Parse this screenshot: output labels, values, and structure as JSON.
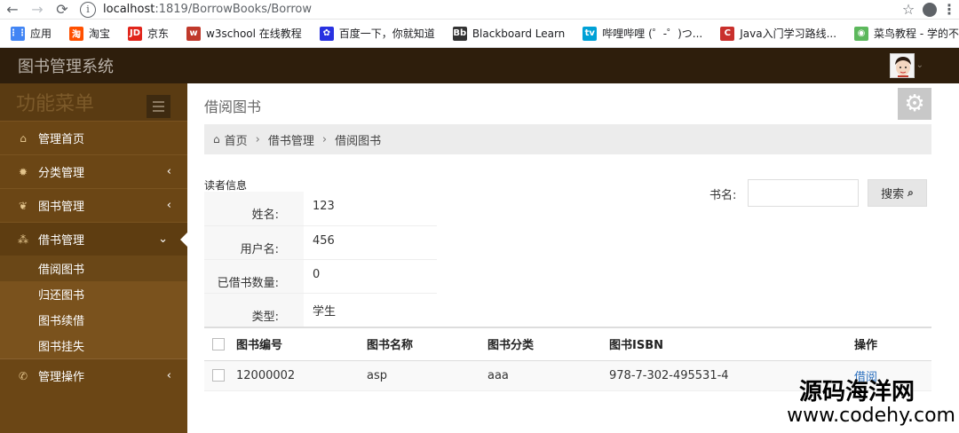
{
  "browser": {
    "host": "localhost",
    "path": ":1819/BorrowBooks/Borrow",
    "bookmarks": [
      {
        "label": "应用",
        "icon": "apps-grid-icon",
        "color": "#4285f4"
      },
      {
        "label": "淘宝",
        "icon": "taobao-icon",
        "color": "#ff5000"
      },
      {
        "label": "京东",
        "icon": "jd-icon",
        "color": "#e1251b"
      },
      {
        "label": "w3school 在线教程",
        "icon": "w3school-icon",
        "color": "#c0392b"
      },
      {
        "label": "百度一下，你就知道",
        "icon": "baidu-paw-icon",
        "color": "#2932e1"
      },
      {
        "label": "Blackboard Learn",
        "icon": "blackboard-icon",
        "color": "#333333"
      },
      {
        "label": "哔哩哔哩 (゜-゜)つ...",
        "icon": "bilibili-icon",
        "color": "#00a1d6"
      },
      {
        "label": "Java入门学习路线...",
        "icon": "csdn-icon",
        "color": "#c9302c"
      },
      {
        "label": "菜鸟教程 - 学的不...",
        "icon": "runoob-icon",
        "color": "#5cb85c"
      }
    ]
  },
  "app": {
    "title": "图书管理系统"
  },
  "sidebar": {
    "header": "功能菜单",
    "items": [
      {
        "label": "管理首页",
        "icon": "home-icon"
      },
      {
        "label": "分类管理",
        "icon": "gear-icon"
      },
      {
        "label": "图书管理",
        "icon": "leaf-icon"
      },
      {
        "label": "借书管理",
        "icon": "sitemap-icon"
      },
      {
        "label": "管理操作",
        "icon": "phone-icon"
      }
    ],
    "sub_items": [
      "借阅图书",
      "归还图书",
      "图书续借",
      "图书挂失"
    ]
  },
  "main": {
    "page_title": "借阅图书",
    "breadcrumb": [
      "首页",
      "借书管理",
      "借阅图书"
    ],
    "reader_label": "读者信息",
    "reader": [
      {
        "key": "姓名:",
        "value": "123"
      },
      {
        "key": "用户名:",
        "value": "456"
      },
      {
        "key": "已借书数量:",
        "value": "0"
      },
      {
        "key": "类型:",
        "value": "学生"
      }
    ],
    "search_label": "书名:",
    "search_value": "",
    "search_button": "搜索",
    "table": {
      "headers": [
        "图书编号",
        "图书名称",
        "图书分类",
        "图书ISBN",
        "操作"
      ],
      "rows": [
        {
          "id": "12000002",
          "name": "asp",
          "category": "aaa",
          "isbn": "978-7-302-495531-4",
          "action": "借阅"
        }
      ]
    }
  },
  "watermark": {
    "line1": "源码海洋网",
    "line2": "www.codehy.com"
  }
}
